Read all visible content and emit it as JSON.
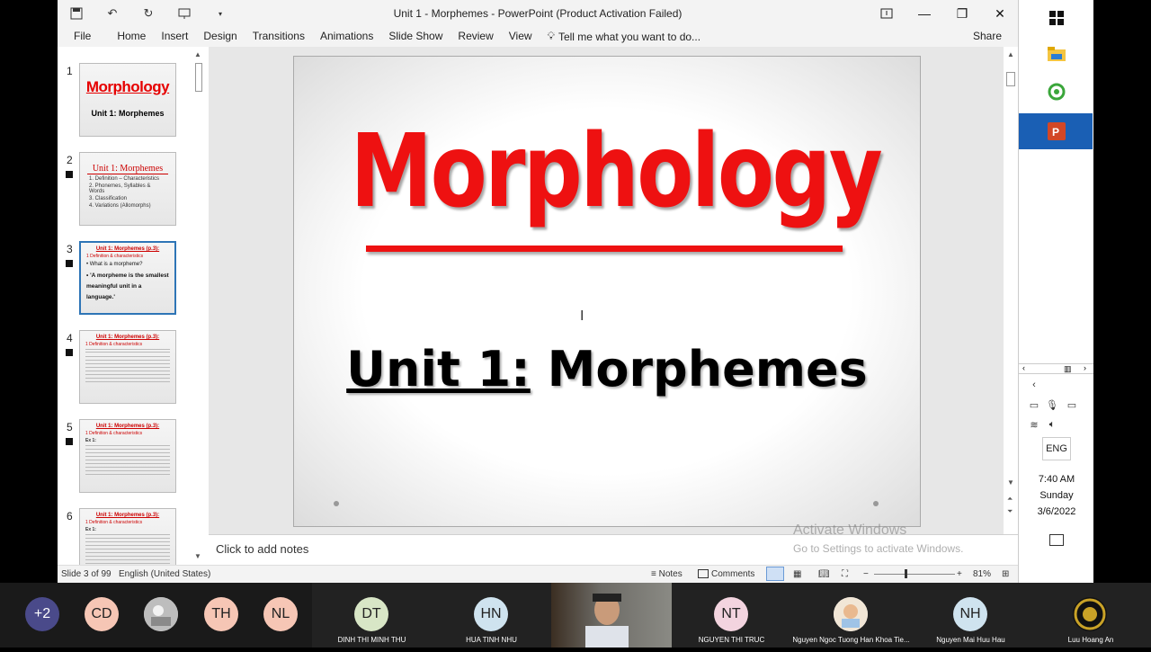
{
  "window": {
    "title": "Unit 1 - Morphemes - PowerPoint (Product Activation Failed)",
    "minimize": "—",
    "restore": "❐",
    "close": "✕"
  },
  "ribbon": {
    "tabs": [
      "File",
      "Home",
      "Insert",
      "Design",
      "Transitions",
      "Animations",
      "Slide Show",
      "Review",
      "View"
    ],
    "tell_me": "Tell me what you want to do...",
    "share": "Share"
  },
  "thumbnails": {
    "numbers": [
      "1",
      "2",
      "3",
      "4",
      "5",
      "6"
    ],
    "t1": {
      "title": "Morphology",
      "subtitle": "Unit 1: Morphemes"
    },
    "t2": {
      "title": "Unit 1: Morphemes",
      "items": [
        "1. Definition – Characteristics",
        "2. Phonemes, Syllables & Words",
        "3. Classification",
        "4. Variations (Allomorphs)"
      ]
    },
    "t3": {
      "head": "Unit 1: Morphemes (p.3):",
      "sub": "1 Definition & characteristics",
      "q": "• What is a morpheme?",
      "def": "• 'A morpheme is the smallest meaningful unit in a language.'"
    },
    "t4": {
      "head": "Unit 1: Morphemes (p.3):",
      "sub": "1 Definition & characteristics"
    },
    "t5": {
      "head": "Unit 1: Morphemes (p.3):",
      "sub": "1 Definition & characteristics",
      "ex": "Ex 1:"
    },
    "t6": {
      "head": "Unit 1: Morphemes (p.3):",
      "sub": "1 Definition & characteristics",
      "ex": "Ex 1:"
    }
  },
  "slide": {
    "title": "Morphology",
    "subtitle_underlined": "Unit 1:",
    "subtitle_rest": "Morphemes"
  },
  "notes": {
    "placeholder": "Click to add notes",
    "watermark_title": "Activate Windows",
    "watermark_sub": "Go to Settings to activate Windows."
  },
  "status": {
    "slide_info": "Slide 3 of 99",
    "language": "English (United States)",
    "notes": "Notes",
    "comments": "Comments",
    "zoom": "81%"
  },
  "taskbar": {
    "lang": "ENG",
    "time": "7:40 AM",
    "day": "Sunday",
    "date": "3/6/2022"
  },
  "meeting": {
    "more": "+2",
    "participants": [
      {
        "initials": "CD",
        "name": "",
        "color": "#f6c6b5"
      },
      {
        "initials": "",
        "name": "",
        "color": "#ccc"
      },
      {
        "initials": "TH",
        "name": "",
        "color": "#f6c6b5"
      },
      {
        "initials": "NL",
        "name": "",
        "color": "#f6c6b5"
      },
      {
        "initials": "DT",
        "name": "DINH THI MINH THU",
        "color": "#d8e6c6"
      },
      {
        "initials": "HN",
        "name": "HUA TINH NHU",
        "color": "#cfe3ef"
      },
      {
        "initials": "NT",
        "name": "NGUYEN THI TRUC",
        "color": "#f3d4df"
      },
      {
        "initials": "",
        "name": "Nguyen Ngoc Tuong Han Khoa Tie...",
        "color": "#eee"
      },
      {
        "initials": "NH",
        "name": "Nguyen Mai Huu Hau",
        "color": "#cfe3ef"
      },
      {
        "initials": "",
        "name": "Luu Hoang An",
        "color": "#111"
      }
    ]
  }
}
